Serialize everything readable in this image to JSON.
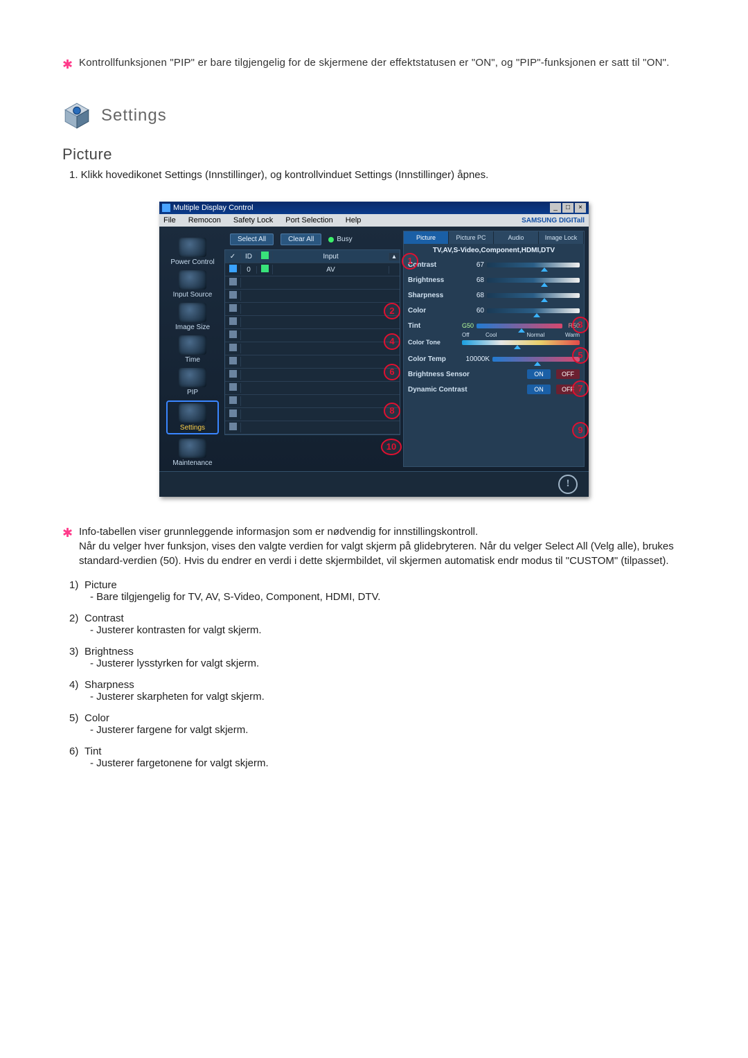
{
  "top_note": "Kontrollfunksjonen \"PIP\" er bare tilgjengelig for de skjermene der effektstatusen er \"ON\", og \"PIP\"-funksjonen er satt til \"ON\".",
  "heading": "Settings",
  "sub_heading": "Picture",
  "intro": "1. Klikk hovedikonet Settings (Innstillinger), og kontrollvinduet Settings (Innstillinger) åpnes.",
  "app": {
    "title": "Multiple Display Control",
    "menu": [
      "File",
      "Remocon",
      "Safety Lock",
      "Port Selection",
      "Help"
    ],
    "brand": "SAMSUNG DIGITall",
    "toolbar": {
      "select_all": "Select All",
      "clear_all": "Clear All",
      "busy": "Busy"
    },
    "sidebar": [
      {
        "label": "Power Control"
      },
      {
        "label": "Input Source"
      },
      {
        "label": "Image Size"
      },
      {
        "label": "Time"
      },
      {
        "label": "PIP"
      },
      {
        "label": "Settings"
      },
      {
        "label": "Maintenance"
      }
    ],
    "grid": {
      "headers": {
        "chk": "✓",
        "id": "ID",
        "st": "",
        "input": "Input"
      },
      "row0": {
        "id": "0",
        "input": "AV"
      }
    },
    "panel": {
      "tabs": [
        "Picture",
        "Picture PC",
        "Audio",
        "Image Lock"
      ],
      "mode": "TV,AV,S-Video,Component,HDMI,DTV",
      "contrast": {
        "label": "Contrast",
        "val": "67"
      },
      "brightness": {
        "label": "Brightness",
        "val": "68"
      },
      "sharpness": {
        "label": "Sharpness",
        "val": "68"
      },
      "color": {
        "label": "Color",
        "val": "60"
      },
      "tint": {
        "label": "Tint",
        "g": "G50",
        "r": "R50"
      },
      "tone": {
        "label": "Color Tone",
        "opts": [
          "Off",
          "Cool",
          "Normal",
          "Warm"
        ]
      },
      "temp": {
        "label": "Color Temp",
        "val": "10000K"
      },
      "bsensor": {
        "label": "Brightness Sensor",
        "on": "ON",
        "off": "OFF"
      },
      "dcontrast": {
        "label": "Dynamic Contrast",
        "on": "ON",
        "off": "OFF"
      }
    }
  },
  "info_para": "Info-tabellen viser grunnleggende informasjon som er nødvendig for innstillingskontroll.\nNår du velger hver funksjon, vises den valgte verdien for valgt skjerm på glidebryteren. Når du velger Select All (Velg alle), brukes standard-verdien (50). Hvis du endrer en verdi i dette skjermbildet, vil skjermen automatisk endr modus til \"CUSTOM\" (tilpasset).",
  "list": [
    {
      "n": "1)",
      "t": "Picture",
      "d": "- Bare tilgjengelig for TV, AV, S-Video, Component, HDMI, DTV."
    },
    {
      "n": "2)",
      "t": "Contrast",
      "d": "- Justerer kontrasten for valgt skjerm."
    },
    {
      "n": "3)",
      "t": "Brightness",
      "d": "- Justerer lysstyrken for valgt skjerm."
    },
    {
      "n": "4)",
      "t": "Sharpness",
      "d": "- Justerer skarpheten for valgt skjerm."
    },
    {
      "n": "5)",
      "t": "Color",
      "d": "- Justerer fargene for valgt skjerm."
    },
    {
      "n": "6)",
      "t": "Tint",
      "d": "- Justerer fargetonene for valgt skjerm."
    }
  ]
}
